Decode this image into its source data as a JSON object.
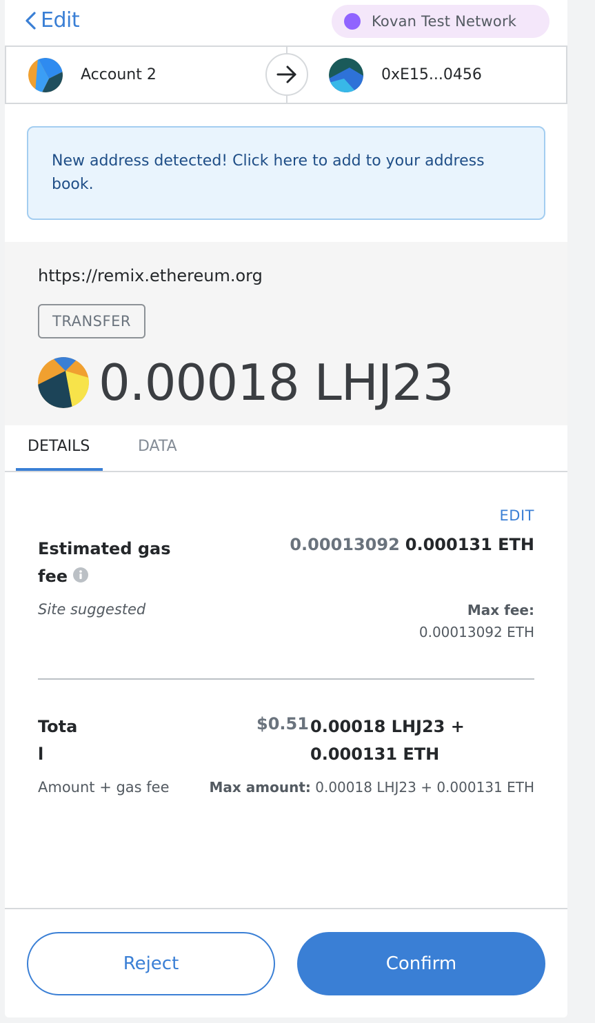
{
  "header": {
    "back_label": "Edit",
    "network_name": "Kovan Test Network",
    "network_color": "#9064ff"
  },
  "parties": {
    "from_name": "Account 2",
    "to_address": "0xE15...0456",
    "arrow_icon": "arrow-right-icon"
  },
  "alert": {
    "message": "New address detected! Click here to add to your address book."
  },
  "summary": {
    "origin": "https://remix.ethereum.org",
    "action": "TRANSFER",
    "amount": "0.00018 LHJ23"
  },
  "tabs": [
    {
      "label": "DETAILS",
      "active": true
    },
    {
      "label": "DATA",
      "active": false
    }
  ],
  "gas": {
    "edit_label": "EDIT",
    "title": "Estimated gas fee",
    "fiat_value": "0.00013092",
    "crypto_value": "0.000131 ETH",
    "site_suggested": "Site suggested",
    "max_fee_label": "Max fee:",
    "max_fee_value": "0.00013092 ETH"
  },
  "total": {
    "title": "Total",
    "fiat_value": "$0.51",
    "value": "0.00018 LHJ23 + 0.000131 ETH",
    "subtitle": "Amount + gas fee",
    "max_amount_label": "Max amount:",
    "max_amount_value": "0.00018 LHJ23 + 0.000131 ETH"
  },
  "footer": {
    "reject_label": "Reject",
    "confirm_label": "Confirm"
  },
  "colors": {
    "accent": "#3a7fd5",
    "alert_bg": "#e9f4fd",
    "network_pill": "#f4e7fa"
  }
}
